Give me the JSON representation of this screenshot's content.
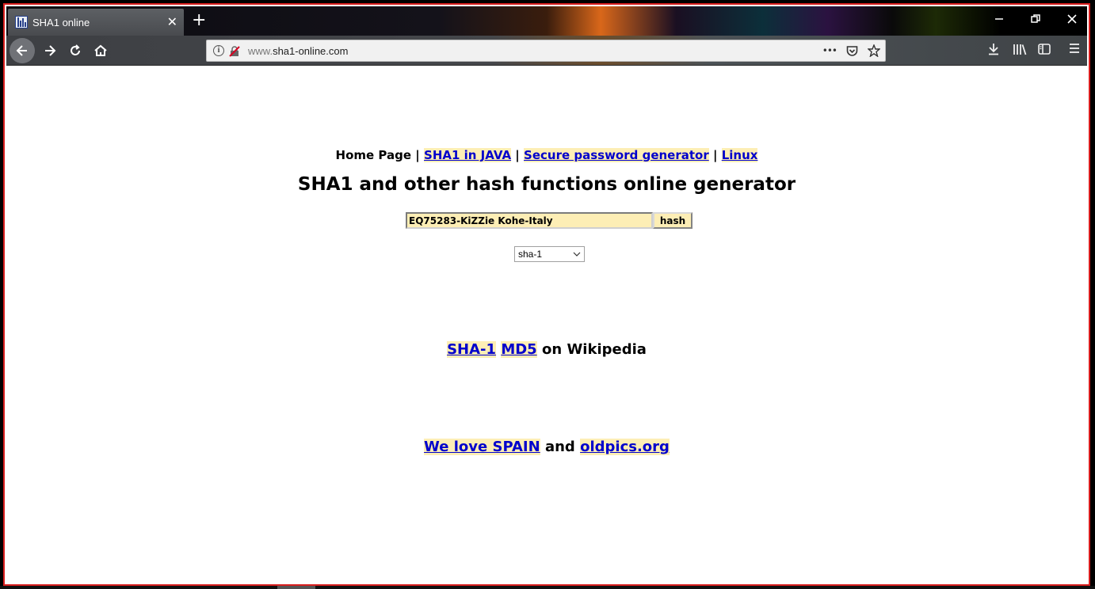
{
  "browser": {
    "tab_title": "SHA1 online",
    "tab_close": "✕",
    "new_tab": "+",
    "url_prefix": "www.",
    "url_domain": "sha1-online.com",
    "page_actions": "•••"
  },
  "page": {
    "nav": {
      "home": "Home Page",
      "sep": "|",
      "java": "SHA1 in JAVA",
      "password": "Secure password generator",
      "linux": "Linux"
    },
    "headline": "SHA1 and other hash functions online generator",
    "input_value": "EQ75283-KiZZie Kohe-Italy",
    "hash_button": "hash",
    "algorithm": "sha-1",
    "wiki": {
      "sha1": "SHA-1",
      "md5": "MD5",
      "suffix": "on Wikipedia"
    },
    "footer": {
      "spain": "We love SPAIN",
      "and": "and",
      "oldpics": "oldpics.org"
    }
  },
  "colors": {
    "highlight": "#fdeeb5",
    "link": "#0000cc",
    "frame": "#d91e1e"
  }
}
